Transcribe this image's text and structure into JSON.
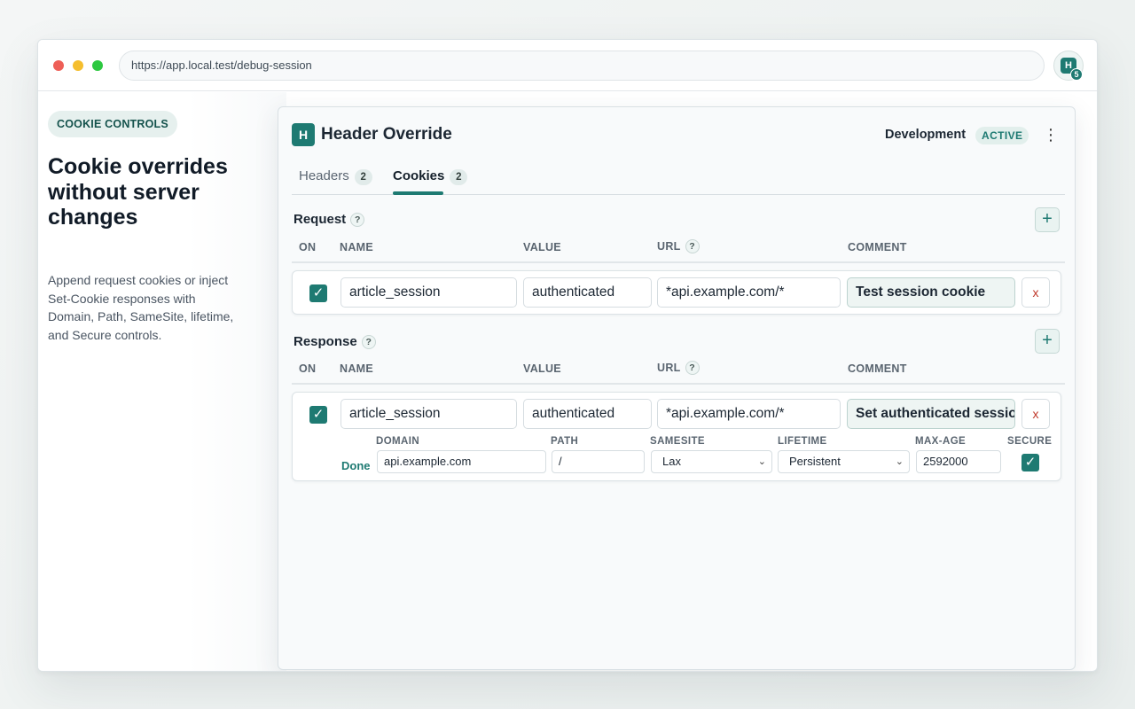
{
  "browser": {
    "url": "https://app.local.test/debug-session",
    "extension_logo": "H",
    "extension_badge": "5"
  },
  "hero": {
    "pill": "COOKIE CONTROLS",
    "title": "Cookie overrides without server changes",
    "description": "Append request cookies or inject Set-Cookie responses with Domain, Path, SameSite, lifetime, and Secure controls."
  },
  "popup": {
    "logo": "H",
    "title": "Header Override",
    "environment": "Development",
    "status": "ACTIVE",
    "menu_icon": "⋮",
    "tabs": [
      {
        "label": "Headers",
        "count": "2"
      },
      {
        "label": "Cookies",
        "count": "2"
      }
    ],
    "columns": {
      "on": "ON",
      "name": "NAME",
      "value": "VALUE",
      "url": "URL",
      "comment": "COMMENT"
    },
    "help": "?",
    "add": "+",
    "delete": "x",
    "check": "✓",
    "request": {
      "title": "Request",
      "row": {
        "name": "article_session",
        "value": "authenticated",
        "url": "*api.example.com/*",
        "comment": "Test session cookie"
      }
    },
    "response": {
      "title": "Response",
      "row": {
        "name": "article_session",
        "value": "authenticated",
        "url": "*api.example.com/*",
        "comment": "Set authenticated session"
      },
      "settings": {
        "labels": {
          "domain": "DOMAIN",
          "path": "PATH",
          "samesite": "SAMESITE",
          "lifetime": "LIFETIME",
          "maxage": "MAX-AGE",
          "secure": "SECURE"
        },
        "done": "Done",
        "domain": "api.example.com",
        "path": "/",
        "samesite": "Lax",
        "lifetime": "Persistent",
        "maxage": "2592000",
        "chevron": "⌄"
      }
    }
  }
}
